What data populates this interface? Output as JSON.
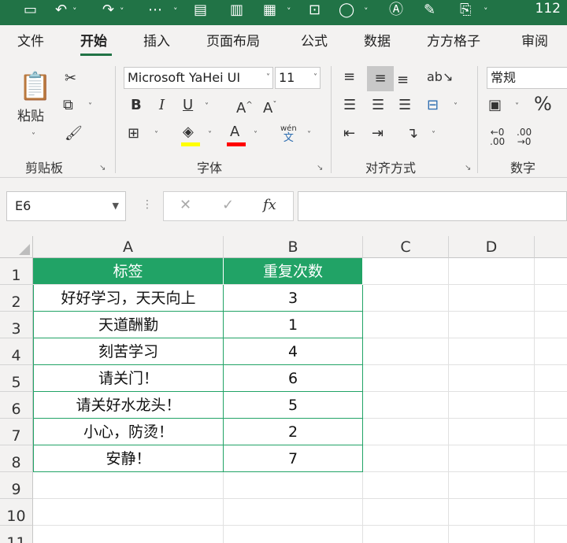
{
  "colors": {
    "excel_green": "#217346",
    "table_header_fill": "#21a366",
    "font_highlight": "#ffff00",
    "font_color": "#ff0000"
  },
  "quick_access": {
    "icons": [
      "save-icon",
      "undo-icon",
      "redo-icon",
      "customize-icon",
      "layout-icon",
      "chart-icon",
      "table-icon",
      "select-icon",
      "shapes-icon",
      "text-box-icon",
      "pen-icon",
      "clipboard-icon"
    ],
    "clip_text": "112"
  },
  "tabs": [
    {
      "label": "文件",
      "active": false
    },
    {
      "label": "开始",
      "active": true
    },
    {
      "label": "插入",
      "active": false
    },
    {
      "label": "页面布局",
      "active": false
    },
    {
      "label": "公式",
      "active": false
    },
    {
      "label": "数据",
      "active": false
    },
    {
      "label": "方方格子",
      "active": false
    },
    {
      "label": "审阅",
      "active": false
    }
  ],
  "ribbon": {
    "clipboard": {
      "paste_label": "粘贴",
      "group_label": "剪贴板"
    },
    "font": {
      "font_name": "Microsoft YaHei UI",
      "font_size": "11",
      "bold": "B",
      "italic": "I",
      "underline": "U",
      "grow": "A",
      "shrink": "A",
      "font_color_glyph": "A",
      "phonetic_top": "wén",
      "phonetic_bottom": "文",
      "group_label": "字体"
    },
    "alignment": {
      "group_label": "对齐方式"
    },
    "number": {
      "format": "常规",
      "percent": "%",
      "group_label": "数字"
    }
  },
  "formula_bar": {
    "name_box": "E6",
    "fx": "fx",
    "formula": ""
  },
  "grid": {
    "columns": [
      "A",
      "B",
      "C",
      "D"
    ],
    "row_numbers": [
      "1",
      "2",
      "3",
      "4",
      "5",
      "6",
      "7",
      "8",
      "9",
      "10",
      "11"
    ],
    "table": {
      "headers": [
        "标签",
        "重复次数"
      ],
      "rows": [
        [
          "好好学习，天天向上",
          "3"
        ],
        [
          "天道酬勤",
          "1"
        ],
        [
          "刻苦学习",
          "4"
        ],
        [
          "请关门！",
          "6"
        ],
        [
          "请关好水龙头！",
          "5"
        ],
        [
          "小心，防烫！",
          "2"
        ],
        [
          "安静！",
          "7"
        ]
      ]
    }
  }
}
